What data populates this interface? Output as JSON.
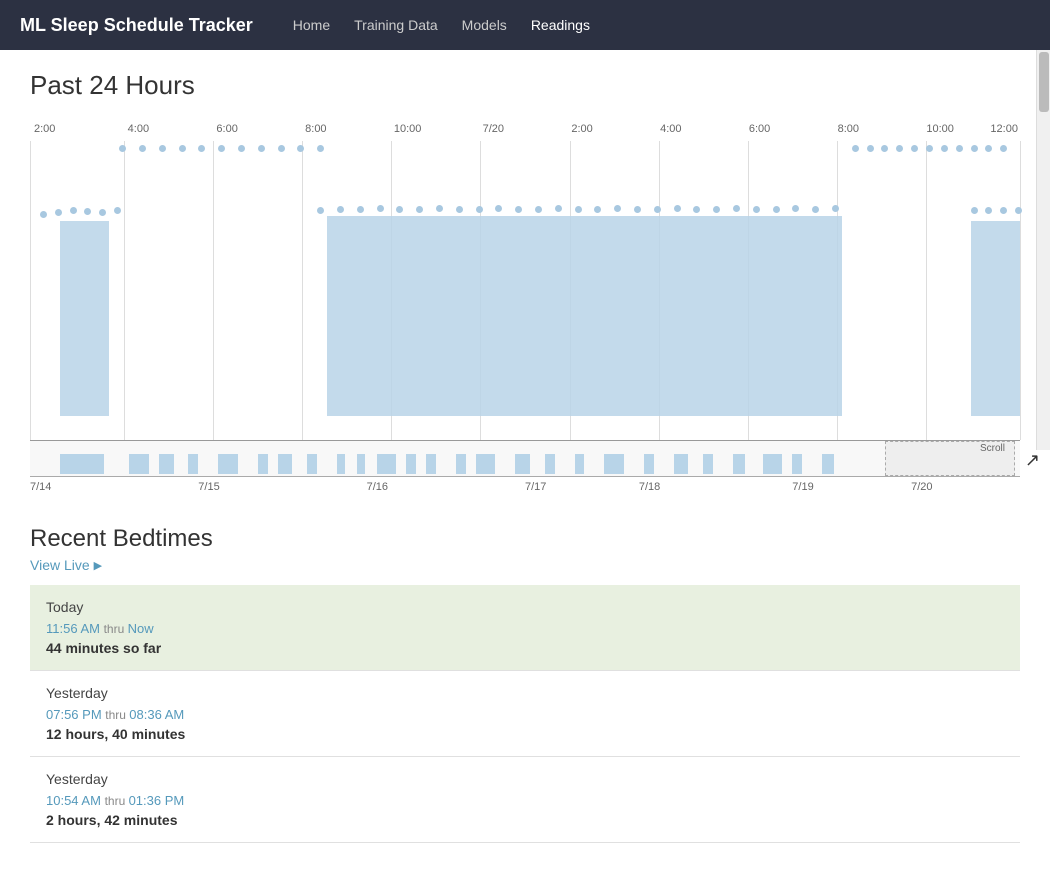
{
  "app": {
    "brand": "ML Sleep Schedule Tracker",
    "nav": [
      {
        "label": "Home",
        "active": false
      },
      {
        "label": "Training Data",
        "active": false
      },
      {
        "label": "Models",
        "active": false
      },
      {
        "label": "Readings",
        "active": true
      }
    ]
  },
  "chart": {
    "title": "Past 24 Hours",
    "top_axis_labels": [
      {
        "label": "2:00",
        "pct": 0
      },
      {
        "label": "4:00",
        "pct": 9.5
      },
      {
        "label": "6:00",
        "pct": 18.5
      },
      {
        "label": "8:00",
        "pct": 27.5
      },
      {
        "label": "10:00",
        "pct": 36.5
      },
      {
        "label": "7/20",
        "pct": 45.5
      },
      {
        "label": "2:00",
        "pct": 54.5
      },
      {
        "label": "4:00",
        "pct": 63.5
      },
      {
        "label": "6:00",
        "pct": 72.5
      },
      {
        "label": "8:00",
        "pct": 81.5
      },
      {
        "label": "10:00",
        "pct": 90.5
      },
      {
        "label": "12:00",
        "pct": 99
      }
    ],
    "bottom_axis_labels": [
      {
        "label": "7/14",
        "pct": 0
      },
      {
        "label": "7/15",
        "pct": 18
      },
      {
        "label": "7/16",
        "pct": 35
      },
      {
        "label": "7/17",
        "pct": 50
      },
      {
        "label": "7/18",
        "pct": 62
      },
      {
        "label": "7/19",
        "pct": 77
      },
      {
        "label": "7/20",
        "pct": 89
      }
    ]
  },
  "bedtimes": {
    "section_title": "Recent Bedtimes",
    "view_live_label": "View Live",
    "view_live_arrow": "▶",
    "entries": [
      {
        "day": "Today",
        "start_time": "11:56 AM",
        "thru": "thru",
        "end_time": "Now",
        "duration": "44 minutes so far",
        "is_today": true
      },
      {
        "day": "Yesterday",
        "start_time": "07:56 PM",
        "thru": "thru",
        "end_time": "08:36 AM",
        "duration": "12 hours, 40 minutes",
        "is_today": false
      },
      {
        "day": "Yesterday",
        "start_time": "10:54 AM",
        "thru": "thru",
        "end_time": "01:36 PM",
        "duration": "2 hours, 42 minutes",
        "is_today": false
      }
    ]
  }
}
